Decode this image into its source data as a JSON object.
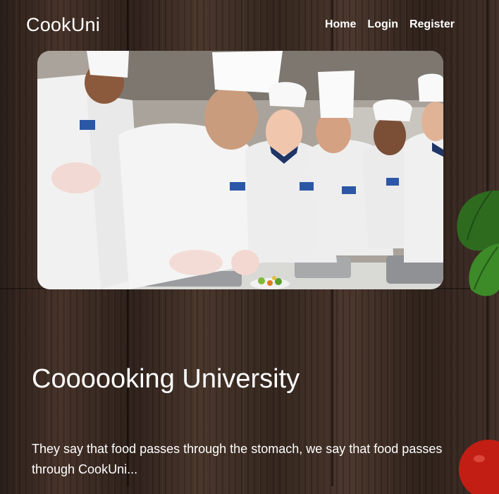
{
  "header": {
    "brand": "CookUni",
    "nav": [
      {
        "label": "Home"
      },
      {
        "label": "Login"
      },
      {
        "label": "Register"
      }
    ]
  },
  "hero": {
    "image_description_icon": "chefs-photo-icon"
  },
  "main": {
    "title": "Coooooking University",
    "tagline": "They say that food passes through the stomach, we say that food passes through CookUni..."
  },
  "colors": {
    "wood_dark": "#2b1f1a",
    "wood_light": "#4a372c",
    "text": "#ffffff",
    "leaf": "#2e6b1f",
    "tomato": "#c21e14"
  }
}
